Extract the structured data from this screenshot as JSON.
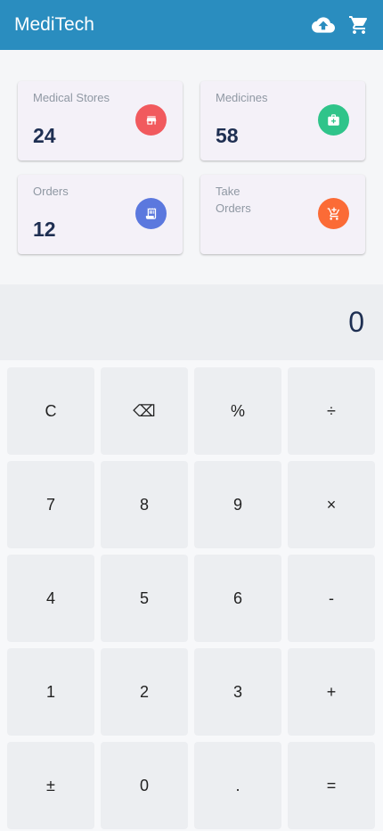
{
  "app": {
    "title": "MediTech",
    "upload_icon": "cloud-upload-icon",
    "cart_icon": "shopping-cart-icon",
    "bar_color": "#2a8dbf"
  },
  "cards": [
    {
      "label": "Medical Stores",
      "value": "24",
      "icon": "store-icon",
      "color": "#f15a5e"
    },
    {
      "label": "Medicines",
      "value": "58",
      "icon": "medical-bag-icon",
      "color": "#2fc48a"
    },
    {
      "label": "Orders",
      "value": "12",
      "icon": "receipt-icon",
      "color": "#5b78de"
    },
    {
      "label": "Take  Orders",
      "value": "",
      "icon": "add-to-cart-icon",
      "color": "#fb6b36"
    }
  ],
  "calculator": {
    "display": "0",
    "keys": [
      [
        "C",
        "⌫",
        "%",
        "÷"
      ],
      [
        "7",
        "8",
        "9",
        "×"
      ],
      [
        "4",
        "5",
        "6",
        "-"
      ],
      [
        "1",
        "2",
        "3",
        "+"
      ],
      [
        "±",
        "0",
        ".",
        "="
      ]
    ]
  }
}
